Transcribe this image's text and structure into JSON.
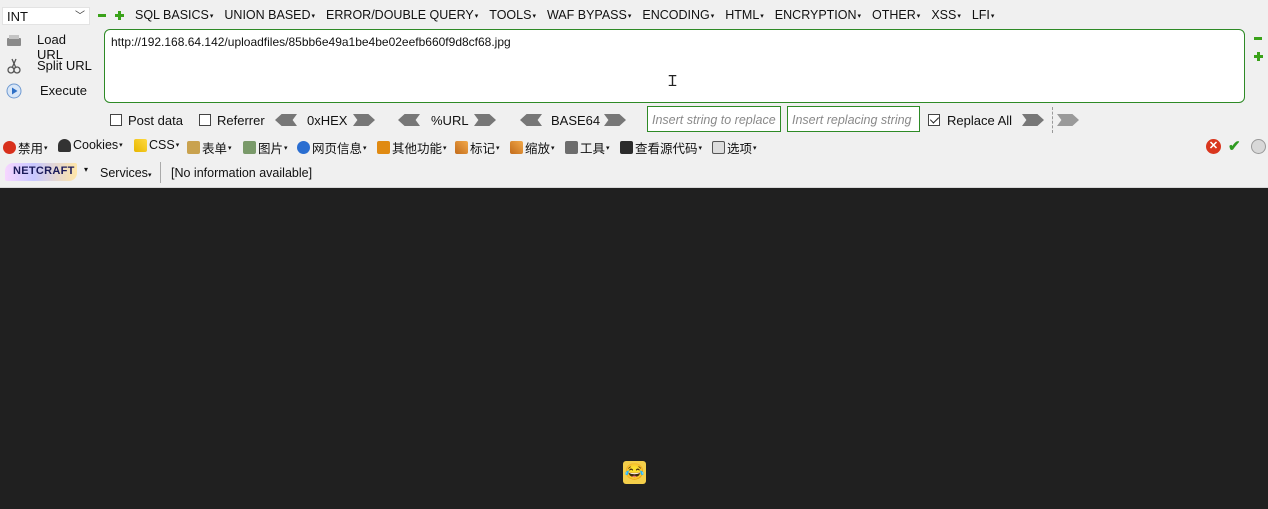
{
  "hackbar": {
    "int_select": "INT",
    "menus": [
      "SQL BASICS",
      "UNION BASED",
      "ERROR/DOUBLE QUERY",
      "TOOLS",
      "WAF BYPASS",
      "ENCODING",
      "HTML",
      "ENCRYPTION",
      "OTHER",
      "XSS",
      "LFI"
    ],
    "load_url": "Load URL",
    "split_url": "Split URL",
    "execute": "Execute",
    "url": "http://192.168.64.142/uploadfiles/85bb6e49a1be4be02eefb660f9d8cf68.jpg",
    "post_data": "Post data",
    "referrer": "Referrer",
    "hex": "0xHEX",
    "urlenc": "%URL",
    "base64": "BASE64",
    "replace_placeholder": "Insert string to replace",
    "replacing_placeholder": "Insert replacing string",
    "replace_all": "Replace All",
    "replace_all_checked": true
  },
  "toolbar": {
    "items": [
      "禁用",
      "Cookies",
      "CSS",
      "表单",
      "图片",
      "网页信息",
      "其他功能",
      "标记",
      "缩放",
      "工具",
      "查看源代码",
      "选项"
    ]
  },
  "netcraft": {
    "logo_text": "NETCRAFT",
    "services": "Services",
    "info": "[No information available]"
  },
  "colors": {
    "accent_green": "#2e8a26",
    "content_bg": "#202020",
    "toolbar_bg": "#f0f0f0"
  }
}
